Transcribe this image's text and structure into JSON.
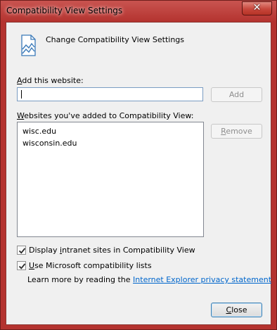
{
  "window": {
    "title": "Compatibility View Settings",
    "close_glyph": "✕"
  },
  "header": {
    "icon": "compatibility-view-icon",
    "text": "Change Compatibility View Settings"
  },
  "add_site": {
    "label_prefix": "",
    "label_accesskey": "A",
    "label_rest": "dd this website:",
    "input_value": "",
    "add_button_label": "Add"
  },
  "sites": {
    "label_accesskey": "W",
    "label_rest": "ebsites you've added to Compatibility View:",
    "items": [
      "wisc.edu",
      "wisconsin.edu"
    ],
    "remove_button_accesskey": "R",
    "remove_button_rest": "emove"
  },
  "options": {
    "intranet_prefix": "Display ",
    "intranet_accesskey": "i",
    "intranet_rest": "ntranet sites in Compatibility View",
    "intranet_checked": true,
    "mslists_accesskey": "U",
    "mslists_rest": "se Microsoft compatibility lists",
    "mslists_checked": true
  },
  "learn_more": {
    "text": "Learn more by reading the ",
    "link_text": "Internet Explorer privacy statement"
  },
  "footer": {
    "close_accesskey": "C",
    "close_rest": "lose"
  },
  "colors": {
    "titlebar": "#b4332f",
    "client_bg": "#f0f0f0",
    "link": "#0066cc"
  }
}
